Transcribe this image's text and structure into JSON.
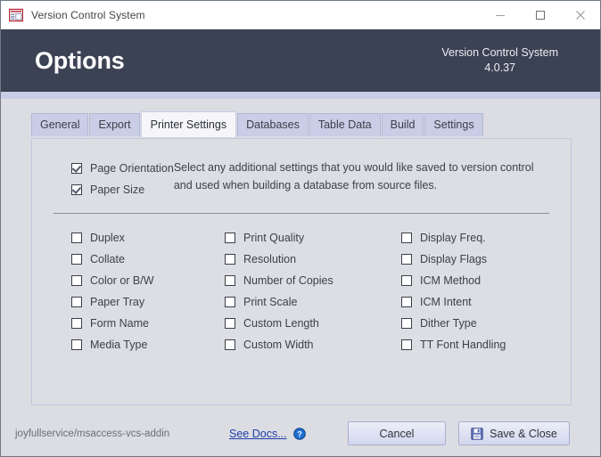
{
  "window": {
    "title": "Version Control System",
    "icon": "access-form-icon",
    "controls": [
      {
        "name": "minimize-button",
        "glyph": "minimize-icon"
      },
      {
        "name": "maximize-button",
        "glyph": "maximize-icon"
      },
      {
        "name": "close-button",
        "glyph": "close-icon"
      }
    ]
  },
  "header": {
    "title": "Options",
    "product": "Version Control System",
    "version": "4.0.37",
    "background": "#3b4254",
    "strip_color": "#c9cde6"
  },
  "tabs": [
    {
      "label": "General",
      "active": false
    },
    {
      "label": "Export",
      "active": false
    },
    {
      "label": "Printer Settings",
      "active": true
    },
    {
      "label": "Databases",
      "active": false
    },
    {
      "label": "Table Data",
      "active": false
    },
    {
      "label": "Build",
      "active": false
    },
    {
      "label": "Settings",
      "active": false
    }
  ],
  "panel": {
    "top_checks": [
      {
        "label": "Page Orientation",
        "checked": true
      },
      {
        "label": "Paper Size",
        "checked": true
      }
    ],
    "description": "Select any additional settings that you would like saved to version control and used when building a database from source files.",
    "grid_columns": [
      {
        "items": [
          {
            "label": "Duplex",
            "checked": false
          },
          {
            "label": "Collate",
            "checked": false
          },
          {
            "label": "Color or B/W",
            "checked": false
          },
          {
            "label": "Paper Tray",
            "checked": false
          },
          {
            "label": "Form Name",
            "checked": false
          },
          {
            "label": "Media Type",
            "checked": false
          }
        ]
      },
      {
        "items": [
          {
            "label": "Print Quality",
            "checked": false
          },
          {
            "label": "Resolution",
            "checked": false
          },
          {
            "label": "Number of Copies",
            "checked": false
          },
          {
            "label": "Print Scale",
            "checked": false
          },
          {
            "label": "Custom Length",
            "checked": false
          },
          {
            "label": "Custom Width",
            "checked": false
          }
        ]
      },
      {
        "items": [
          {
            "label": "Display Freq.",
            "checked": false
          },
          {
            "label": "Display Flags",
            "checked": false
          },
          {
            "label": "ICM Method",
            "checked": false
          },
          {
            "label": "ICM Intent",
            "checked": false
          },
          {
            "label": "Dither Type",
            "checked": false
          },
          {
            "label": "TT Font Handling",
            "checked": false
          }
        ]
      }
    ]
  },
  "footer": {
    "repo": "joyfullservice/msaccess-vcs-addin",
    "docs_link": "See Docs...",
    "help_icon": "help-circle-icon",
    "cancel_label": "Cancel",
    "save_label": "Save & Close",
    "save_icon": "floppy-disk-icon",
    "link_color": "#1f3fa8"
  }
}
